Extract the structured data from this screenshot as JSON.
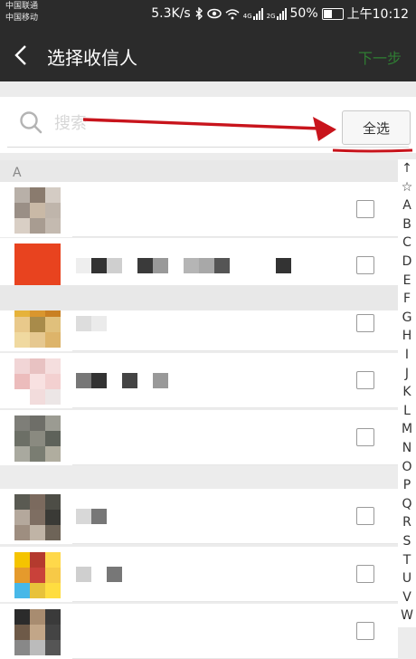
{
  "status_bar": {
    "carrier1": "中国联通",
    "carrier2": "中国移动",
    "speed": "5.3K/s",
    "net1": "4G",
    "net2": "2G",
    "battery": "50%",
    "time": "上午10:12",
    "battery_level": 0.5
  },
  "nav": {
    "title": "选择收信人",
    "next_label": "下一步"
  },
  "search": {
    "placeholder": "搜索",
    "value": ""
  },
  "select_all_label": "全选",
  "sections": [
    {
      "letter": "A"
    },
    {
      "letter": ""
    }
  ],
  "index_bar": [
    "↑",
    "☆",
    "A",
    "B",
    "C",
    "D",
    "E",
    "F",
    "G",
    "H",
    "I",
    "J",
    "K",
    "L",
    "M",
    "N",
    "O",
    "P",
    "Q",
    "R",
    "S",
    "T",
    "U",
    "V",
    "W"
  ],
  "contacts": [
    {
      "avatar": [
        "#b8b0a8",
        "#8a7b6e",
        "#d4ccc4",
        "#9a8f86",
        "#c9b9a6",
        "#bfb5ab",
        "#d9cfc5",
        "#a89c91",
        "#c4bab0"
      ],
      "name": [],
      "checked": false
    },
    {
      "avatar": [
        "#e8431f",
        "#e8431f",
        "#e8431f",
        "#e8431f",
        "#e8431f",
        "#e8431f",
        "#e8431f",
        "#e8431f",
        "#e8431f"
      ],
      "name": [
        "#eeeeee",
        "#333333",
        "#cfcfcf",
        "#ffffff",
        "#3a3a3a",
        "#999999",
        "#ffffff",
        "#b5b5b5",
        "#a8a8a8",
        "#555555",
        "#ffffff",
        "#ffffff",
        "#ffffff",
        "#333333"
      ],
      "checked": false
    },
    {
      "avatar": [
        "#e6b23a",
        "#d9962e",
        "#c98023",
        "#e9c98b",
        "#a88b4a",
        "#e0c07c",
        "#f0d9a0",
        "#e6c890",
        "#ddb46a"
      ],
      "name": [
        "#dddddd",
        "#ebebeb"
      ],
      "checked": false
    },
    {
      "avatar": [
        "#f1d5d6",
        "#e8c2c2",
        "#f5dede",
        "#ecbcbc",
        "#f8e1e1",
        "#f3d0d0",
        "#ffffff",
        "#f2dcdc",
        "#ece6e6"
      ],
      "name": [
        "#777777",
        "#333333",
        "#ffffff",
        "#444444",
        "#ffffff",
        "#999999"
      ],
      "checked": false
    },
    {
      "avatar": [
        "#7e7e78",
        "#6e6e68",
        "#9b9b92",
        "#6c6f66",
        "#8a8a80",
        "#5e625a",
        "#a9a99f",
        "#7a7d72",
        "#b0ad9f"
      ],
      "name": [],
      "checked": false
    },
    {
      "avatar": [
        "#5a5a52",
        "#7b6a5e",
        "#4d4d46",
        "#b4a89c",
        "#7e6e62",
        "#3a3a36",
        "#9e8e80",
        "#c0b4a6",
        "#6e6458"
      ],
      "name": [
        "#d8d8d8",
        "#777777"
      ],
      "checked": false
    },
    {
      "avatar": [
        "#f5c400",
        "#b43a2e",
        "#ffd84a",
        "#e59a2c",
        "#c9413a",
        "#f7c947",
        "#48b8e8",
        "#e8c23a",
        "#ffdd40"
      ],
      "name": [
        "#cfcfcf",
        "#ffffff",
        "#777777"
      ],
      "checked": false
    },
    {
      "avatar": [
        "#2b2b2b",
        "#a88c70",
        "#3a3a3a",
        "#6e5a48",
        "#c2a688",
        "#444444",
        "#888888",
        "#bbbbbb",
        "#555555"
      ],
      "name": [],
      "checked": false
    }
  ]
}
